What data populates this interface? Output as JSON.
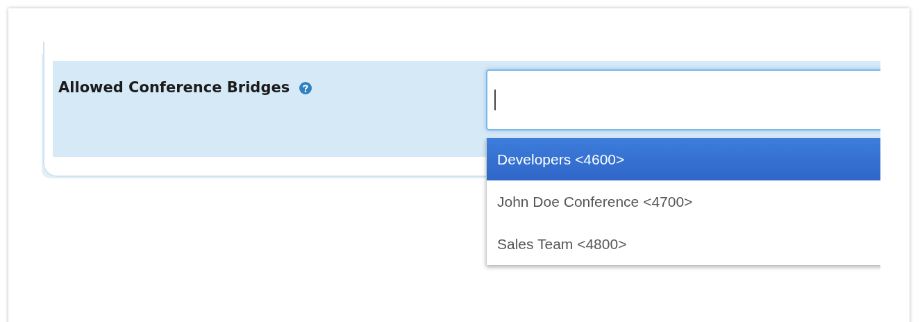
{
  "field": {
    "label": "Allowed Conference Bridges",
    "focused": true
  },
  "suggestions": [
    {
      "label": "Developers <4600>",
      "selected": true
    },
    {
      "label": "John Doe Conference <4700>",
      "selected": false
    },
    {
      "label": "Sales Team <4800>",
      "selected": false
    }
  ]
}
